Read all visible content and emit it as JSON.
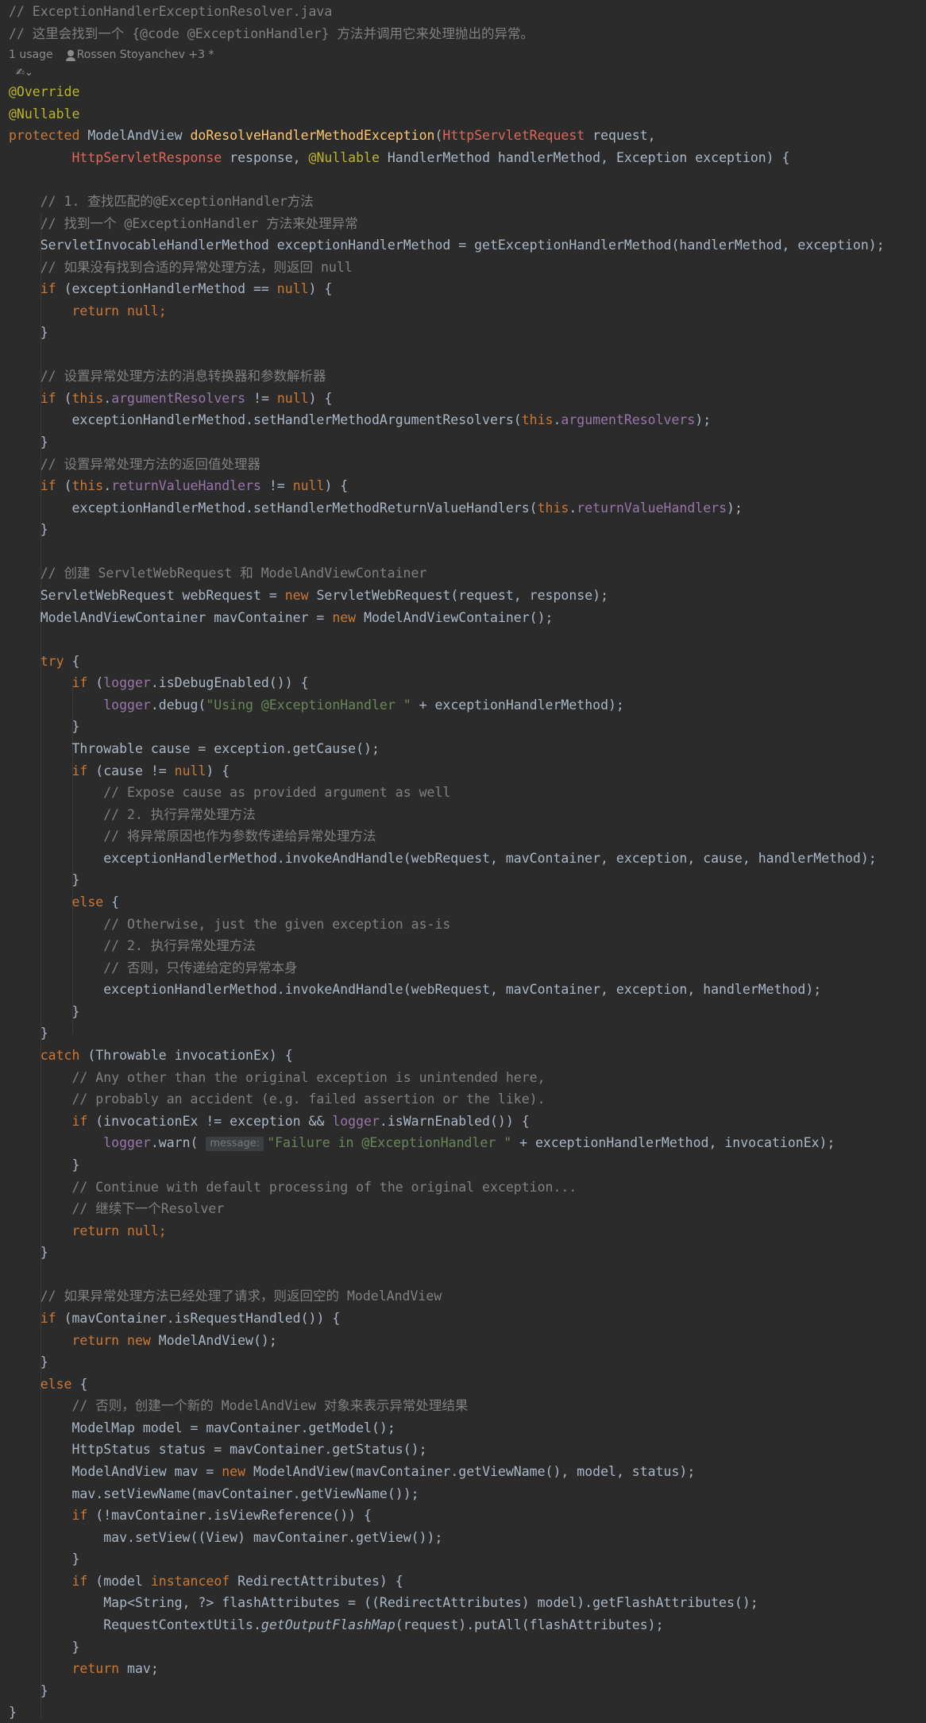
{
  "file_header": {
    "filename_comment": "// ExceptionHandlerExceptionResolver.java",
    "doc_comment": "// 这里会找到一个 {@code @ExceptionHandler} 方法并调用它来处理抛出的异常。"
  },
  "inlay": {
    "usage": "1 usage",
    "author": "Rossen Stoyanchev +3 *",
    "ai_hint": "✍⌄"
  },
  "code": {
    "ann_override": "@Override",
    "ann_nullable": "@Nullable",
    "kw_protected": "protected",
    "type_mav": "ModelAndView",
    "method_name": "doResolveHandlerMethodException",
    "req_type": "HttpServletRequest",
    "req_name": "request,",
    "resp_type": "HttpServletResponse",
    "resp_rest": "response,",
    "ann_nullable2": "@Nullable",
    "hm_params": "HandlerMethod handlerMethod, Exception exception) {",
    "cm_step1": "// 1. 查找匹配的@ExceptionHandler方法",
    "cm_find": "// 找到一个 @ExceptionHandler 方法来处理异常",
    "decl_ehm": "ServletInvocableHandlerMethod exceptionHandlerMethod = getExceptionHandlerMethod(handlerMethod, exception);",
    "cm_notfound": "// 如果没有找到合适的异常处理方法，则返回 null",
    "if_null_cond": "(exceptionHandlerMethod == ",
    "ret_null": "null;",
    "cm_resolvers": "// 设置异常处理方法的消息转换器和参数解析器",
    "field_arg": "argumentResolvers",
    "set_arg_call": "exceptionHandlerMethod.setHandlerMethodArgumentResolvers(",
    "cm_return_handlers": "// 设置异常处理方法的返回值处理器",
    "field_rvh": "returnValueHandlers",
    "set_rvh_call": "exceptionHandlerMethod.setHandlerMethodReturnValueHandlers(",
    "cm_create": "// 创建 ServletWebRequest 和 ModelAndViewContainer",
    "decl_webreq": "ServletWebRequest webRequest = ",
    "ctor_webreq": "ServletWebRequest(request, response);",
    "decl_mavc": "ModelAndViewContainer mavContainer = ",
    "ctor_mavc": "ModelAndViewContainer();",
    "kw_try": "try",
    "logger": "logger",
    "is_debug": ".isDebugEnabled()) {",
    "debug_call": ".debug(",
    "str_using": "\"Using @ExceptionHandler \"",
    "debug_rest": " + exceptionHandlerMethod);",
    "decl_cause": "Throwable cause = exception.getCause();",
    "if_cause": "(cause != ",
    "cm_expose": "// Expose cause as provided argument as well",
    "cm_step2": "// 2. 执行异常处理方法",
    "cm_pass_cause": "// 将异常原因也作为参数传递给异常处理方法",
    "invoke_with_cause": "exceptionHandlerMethod.invokeAndHandle(webRequest, mavContainer, exception, cause, handlerMethod);",
    "kw_else": "else",
    "cm_otherwise": "// Otherwise, just the given exception as-is",
    "cm_step2b": "// 2. 执行异常处理方法",
    "cm_only_ex": "// 否则，只传递给定的异常本身",
    "invoke_no_cause": "exceptionHandlerMethod.invokeAndHandle(webRequest, mavContainer, exception, handlerMethod);",
    "kw_catch": "catch",
    "catch_params": "(Throwable invocationEx) {",
    "cm_any_other": "// Any other than the original exception is unintended here,",
    "cm_probably": "// probably an accident (e.g. failed assertion or the like).",
    "if_invocation": "(invocationEx != exception && ",
    "is_warn": ".isWarnEnabled()) {",
    "warn_call": ".warn(",
    "hint_message": "message:",
    "str_failure": "\"Failure in @ExceptionHandler \"",
    "warn_rest": " + exceptionHandlerMethod, invocationEx);",
    "cm_continue": "// Continue with default processing of the original exception...",
    "cm_next_resolver": "// 继续下一个Resolver",
    "cm_handled": "// 如果异常处理方法已经处理了请求，则返回空的 ModelAndView",
    "if_handled": "(mavContainer.isRequestHandled()) {",
    "ctor_mav_empty": "ModelAndView();",
    "cm_else_create": "// 否则，创建一个新的 ModelAndView 对象来表示异常处理结果",
    "decl_model": "ModelMap model = mavContainer.getModel();",
    "decl_status": "HttpStatus status = mavContainer.getStatus();",
    "decl_mav": "ModelAndView mav = ",
    "ctor_mav_full": "ModelAndView(mavContainer.getViewName(), model, status);",
    "set_view_name": "mav.setViewName(mavContainer.getViewName());",
    "if_view_ref": "(!mavContainer.isViewReference()) {",
    "set_view": "mav.setView((View) mavContainer.getView());",
    "if_model_open": "(model ",
    "kw_instanceof": "instanceof",
    "redirect_attrs": " RedirectAttributes) {",
    "decl_flash": "Map<String, ?> flashAttributes = ((RedirectAttributes) model).getFlashAttributes();",
    "rcu": "RequestContextUtils.",
    "get_output_flash": "getOutputFlashMap",
    "put_all": "(request).putAll(flashAttributes);",
    "ret_mav": "mav;"
  }
}
